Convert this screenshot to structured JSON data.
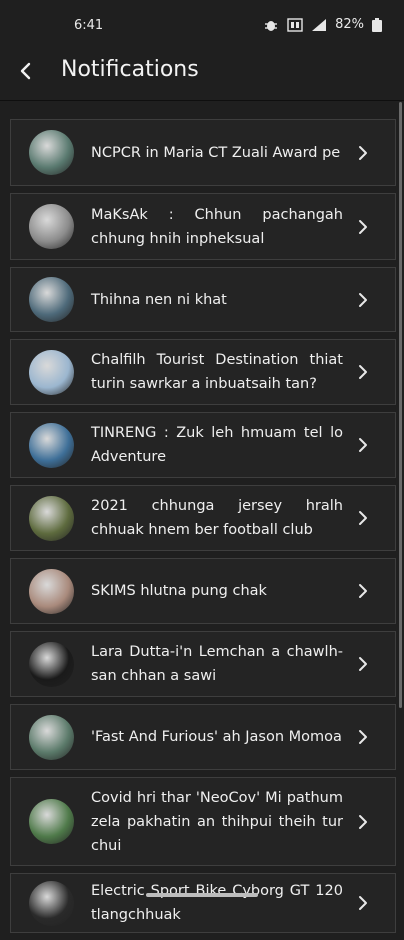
{
  "status_bar": {
    "time": "6:41",
    "battery": "82%",
    "icons": [
      "bug-icon",
      "volte-icon",
      "signal-icon",
      "battery-icon"
    ]
  },
  "header": {
    "title": "Notifications",
    "back_icon": "chevron-left-icon"
  },
  "notifications": [
    {
      "text": "NCPCR in Maria CT Zuali Award pe",
      "avatar_color": "#5a7a70"
    },
    {
      "text": "MaKsAk : Chhun pachangah chhung hnih inpheksual",
      "avatar_color": "#8c8c8c"
    },
    {
      "text": "Thihna nen ni khat",
      "avatar_color": "#4e6a7a"
    },
    {
      "text": "Chalfilh Tourist Destination thiat turin sawrkar a inbuatsaih tan?",
      "avatar_color": "#9bb6cf"
    },
    {
      "text": "TINRENG : Zuk leh hmuam tel lo Adventure",
      "avatar_color": "#3e6f98"
    },
    {
      "text": "2021 chhunga jersey hralh chhuak hnem ber football club",
      "avatar_color": "#5e6b3e"
    },
    {
      "text": "SKIMS hlutna pung chak",
      "avatar_color": "#a98a7c"
    },
    {
      "text": "Lara Dutta-i'n Lemchan a chawlh-san chhan a sawi",
      "avatar_color": "#1a1a1a"
    },
    {
      "text": "'Fast And Furious' ah Jason Momoa",
      "avatar_color": "#5b7a6a"
    },
    {
      "text": "Covid hri thar 'NeoCov' Mi pathum zela pakhatin an thihpui theih tur chui",
      "avatar_color": "#4f7a4a"
    },
    {
      "text": "Electric Sport Bike Cyborg GT 120 tlangchhuak",
      "avatar_color": "#2a2a2a"
    }
  ]
}
